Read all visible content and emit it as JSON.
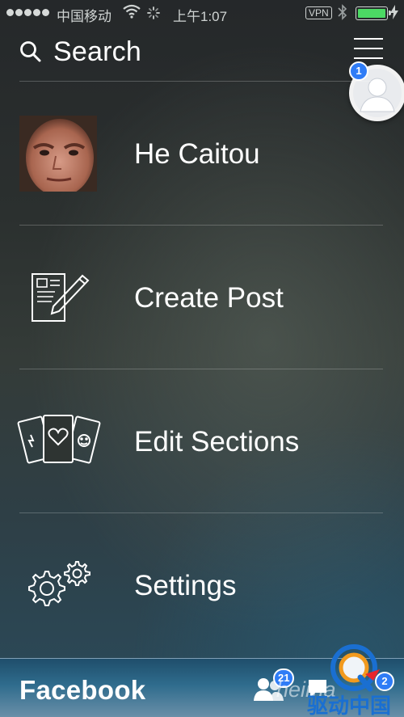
{
  "status_bar": {
    "carrier": "中国移动",
    "time": "上午1:07",
    "vpn": "VPN",
    "battery_level": 1.0
  },
  "header": {
    "search_label": "Search",
    "profile_badge_count": "1"
  },
  "menu": {
    "items": [
      {
        "label": "He Caitou",
        "icon": "user-avatar"
      },
      {
        "label": "Create Post",
        "icon": "compose-icon"
      },
      {
        "label": "Edit Sections",
        "icon": "cards-icon"
      },
      {
        "label": "Settings",
        "icon": "gears-icon"
      }
    ]
  },
  "bottom_bar": {
    "brand": "Facebook",
    "friend_requests_count": "21",
    "messages_count": "2"
  },
  "watermark": {
    "text": "heima",
    "logo_text": "驱动中国"
  },
  "colors": {
    "accent_badge": "#2f7cf6",
    "battery_fill": "#4cd964"
  }
}
